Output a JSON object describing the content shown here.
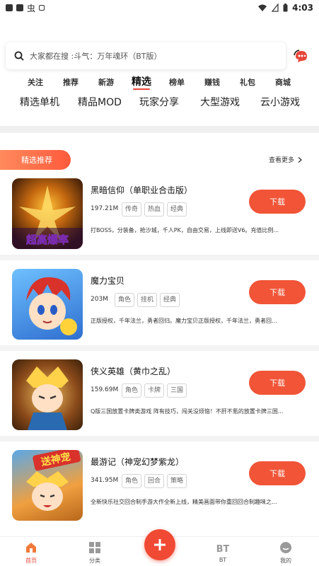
{
  "status_bar": {
    "time": "4:03",
    "left_label": "虫"
  },
  "search": {
    "placeholder": "大家都在搜 :斗气：万年魂环（BT版）"
  },
  "nav_tabs": [
    "关注",
    "推荐",
    "新游",
    "精选",
    "榜单",
    "赚钱",
    "礼包",
    "商城"
  ],
  "nav_active_index": 3,
  "sub_tabs": [
    "精选单机",
    "精品MOD",
    "玩家分享",
    "大型游戏",
    "云小游戏"
  ],
  "section": {
    "title": "精选推荐",
    "see_more": "查看更多"
  },
  "games": [
    {
      "title": "黑暗信仰（单职业合击版）",
      "size": "197.21M",
      "tags": [
        "传奇",
        "热血",
        "经典"
      ],
      "desc": "打BOSS，分装备，抢沙城，千人PK，自由交易，上线即送V6。充值比例...",
      "download": "下载",
      "thumb_text": "超高爆率",
      "theme": "#3a1a08"
    },
    {
      "title": "魔力宝贝",
      "size": "203M",
      "tags": [
        "角色",
        "挂机",
        "经典"
      ],
      "desc": "正版授权，千年法兰，勇者回归。魔力宝贝正版授权，千年法兰，勇者回...",
      "download": "下载",
      "thumb_text": "",
      "theme": "#3f8ad8"
    },
    {
      "title": "侠义英雄（黄巾之乱）",
      "size": "159.69M",
      "tags": [
        "角色",
        "卡牌",
        "三国"
      ],
      "desc": "Q版三国放置卡牌类游戏 阵有技巧，闯关没烦恼！不肝不氪的放置卡牌三国...",
      "download": "下载",
      "thumb_text": "",
      "theme": "#6a3a1a"
    },
    {
      "title": "最游记（神宠幻梦紫龙）",
      "size": "341.95M",
      "tags": [
        "角色",
        "回合",
        "策略"
      ],
      "desc": "全新快乐社交回合制手游大作全新上线，精美画面带你重回回合制趣味之...",
      "download": "下载",
      "thumb_text": "送神宠",
      "theme": "#b8661a"
    }
  ],
  "bottom_nav": [
    {
      "label": "首页",
      "icon": "home-icon"
    },
    {
      "label": "分类",
      "icon": "grid-icon"
    },
    {
      "label": "BT",
      "icon": "bt-icon"
    },
    {
      "label": "我的",
      "icon": "user-icon"
    }
  ],
  "colors": {
    "accent": "#f15437",
    "badge_start": "#ff8a5c"
  }
}
